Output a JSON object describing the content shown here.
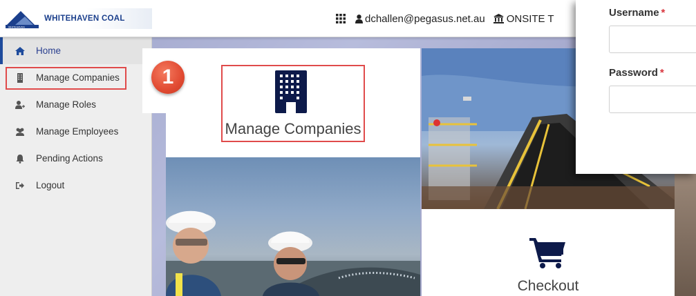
{
  "header": {
    "logo_text": "WHITEHAVEN COAL",
    "logo_sub": "WHITEHAVEN",
    "user_email": "dchallen@pegasus.net.au",
    "site_label": "ONSITE T",
    "icons": [
      "grid-icon",
      "user-icon",
      "bank-icon"
    ]
  },
  "sidebar": {
    "items": [
      {
        "label": "Home",
        "icon": "home-icon"
      },
      {
        "label": "Manage Companies",
        "icon": "building-icon"
      },
      {
        "label": "Manage Roles",
        "icon": "user-plus-icon"
      },
      {
        "label": "Manage Employees",
        "icon": "users-icon"
      },
      {
        "label": "Pending Actions",
        "icon": "bell-icon"
      },
      {
        "label": "Logout",
        "icon": "logout-icon"
      }
    ]
  },
  "step_badge": "1",
  "tiles": {
    "manage_companies": "Manage Companies",
    "checkout": "Checkout"
  },
  "login": {
    "username_label": "Username",
    "password_label": "Password",
    "required_mark": "*",
    "username_value": "",
    "password_value": ""
  },
  "colors": {
    "brand_blue": "#1b3f8c",
    "highlight_red": "#e04a4a",
    "badge_red": "#e14a32",
    "icon_navy": "#0d1a4a"
  }
}
